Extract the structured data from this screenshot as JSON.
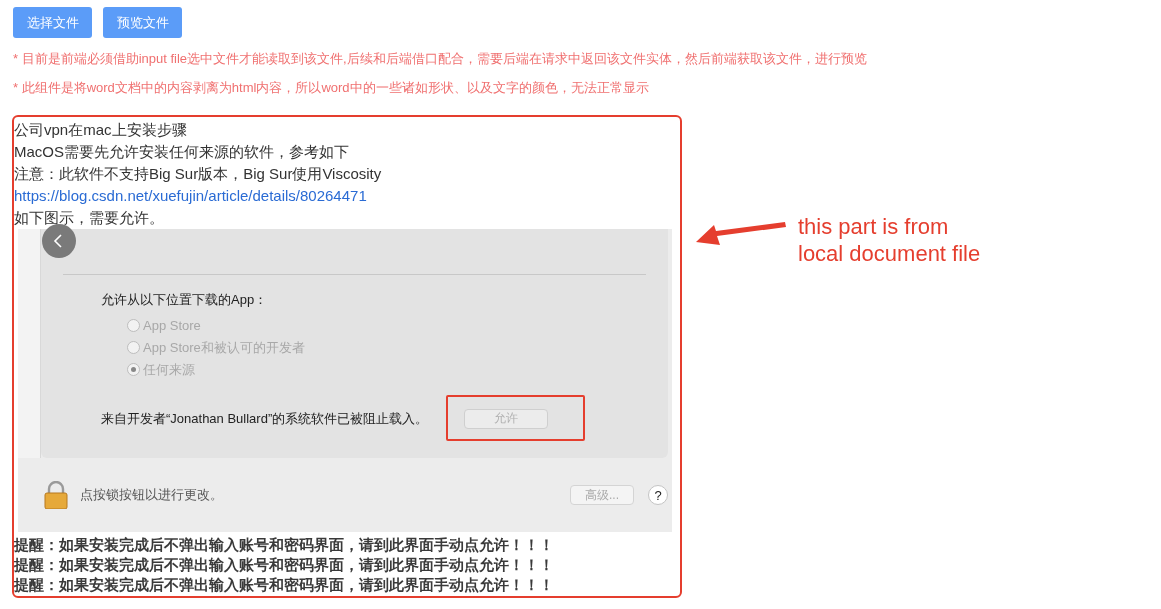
{
  "toolbar": {
    "buttons": [
      "选择文件",
      "预览文件"
    ]
  },
  "notes": [
    "* 目前是前端必须借助input file选中文件才能读取到该文件,后续和后端借口配合，需要后端在请求中返回该文件实体，然后前端获取该文件，进行预览",
    "* 此组件是将word文档中的内容剥离为html内容，所以word中的一些诸如形状、以及文字的颜色，无法正常显示"
  ],
  "document": {
    "lines": [
      {
        "kind": "text",
        "text": "公司vpn在mac上安装步骤"
      },
      {
        "kind": "text",
        "text": "MacOS需要先允许安装任何来源的软件，参考如下"
      },
      {
        "kind": "text",
        "text": "注意：此软件不支持Big Sur版本，Big Sur使用Viscosity"
      },
      {
        "kind": "link",
        "text": "https://blog.csdn.net/xuefujin/article/details/80264471"
      },
      {
        "kind": "text",
        "text": "如下图示，需要允许。"
      }
    ],
    "screenshot": {
      "heading": "允许从以下位置下载的App：",
      "options": [
        {
          "label": "App Store",
          "selected": false,
          "disabled": true
        },
        {
          "label": "App Store和被认可的开发者",
          "selected": false,
          "disabled": true
        },
        {
          "label": "任何来源",
          "selected": true,
          "disabled": true
        }
      ],
      "blocked_message": "来自开发者“Jonathan Bullard”的系统软件已被阻止载入。",
      "allow_button": "允许",
      "lock_message": "点按锁按钮以进行更改。",
      "advanced_button": "高级...",
      "help_button": "?"
    },
    "reminders": [
      "提醒：如果安装完成后不弹出输入账号和密码界面，请到此界面手动点允许！！！",
      "提醒：如果安装完成后不弹出输入账号和密码界面，请到此界面手动点允许！！！",
      "提醒：如果安装完成后不弹出输入账号和密码界面，请到此界面手动点允许！！！"
    ]
  },
  "annotation": {
    "text": "this part is from local document file"
  }
}
